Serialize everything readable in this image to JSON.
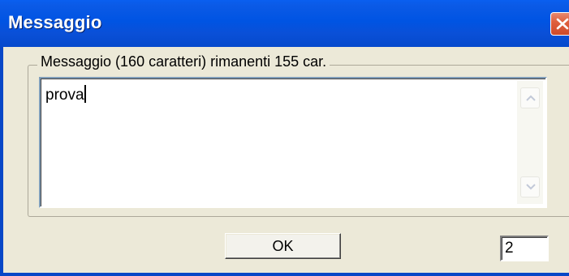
{
  "window": {
    "title": "Messaggio"
  },
  "message_group": {
    "legend": "Messaggio (160 caratteri) rimanenti 155 car.",
    "text_value": "prova"
  },
  "buttons": {
    "ok_label": "OK"
  },
  "counter": {
    "value": "2"
  },
  "colors": {
    "titlebar": "#0054e3",
    "dialog_background": "#ece9d8",
    "close_button": "#e0603e"
  },
  "icons": {
    "close": "close-icon",
    "scroll_up": "scroll-up-icon",
    "scroll_down": "scroll-down-icon"
  }
}
